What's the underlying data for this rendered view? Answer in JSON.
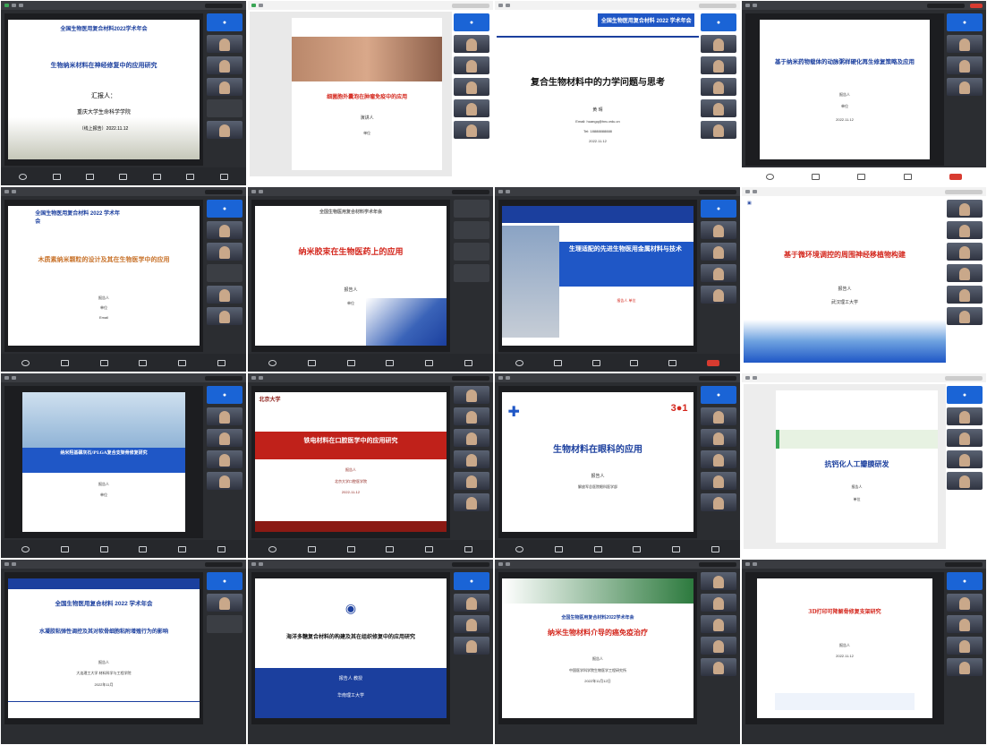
{
  "colors": {
    "red_title": "#d4271d",
    "blue_title": "#1b3f9e",
    "band_blue": "#1f57c6",
    "dark_band": "#8b1a14"
  },
  "cells": [
    {
      "id": "c1",
      "header": "全国生物医用复合材料2022学术年会",
      "title": "生物纳米材料在神经修复中的应用研究",
      "lines": [
        "汇报人：",
        "重庆大学生命科学学院",
        "（线上报告）2022.11.12"
      ]
    },
    {
      "id": "c2",
      "header": "",
      "title": "细菌胞外囊泡在肿瘤免疫中的应用",
      "lines": [
        "演讲人",
        "单位",
        ""
      ]
    },
    {
      "id": "c3",
      "header": "全国生物医用复合材料 2022 学术年会",
      "title": "复合生物材料中的力学问题与思考",
      "lines": [
        "黄  晴",
        "Email: huangq@hnu.edu.cn",
        "Tel: 18888888888",
        "2022.11.12"
      ]
    },
    {
      "id": "c4",
      "header": "",
      "title": "基于纳米药物载体的动脉粥样硬化再生修复策略及应用",
      "lines": [
        "报告人",
        "单位",
        "2022.11.12"
      ]
    },
    {
      "id": "c5",
      "header": "全国生物医用复合材料 2022 学术年会",
      "title": "木质素纳米颗粒的设计及其在生物医学中的应用",
      "lines": [
        "报告人",
        "单位",
        "Email"
      ]
    },
    {
      "id": "c6",
      "header": "全国生物医用复合材料学术年会",
      "title": "纳米胶束在生物医药上的应用",
      "lines": [
        "报告人",
        "单位"
      ]
    },
    {
      "id": "c7",
      "header": "",
      "title": "生理适配的先进生物医用金属材料与技术",
      "lines": [
        "报告人 单位"
      ]
    },
    {
      "id": "c8",
      "header": "",
      "title": "基于微环境调控的周围神经移植物构建",
      "lines": [
        "报告人",
        "武汉理工大学"
      ]
    },
    {
      "id": "c9",
      "header": "",
      "title": "纳米羟基磷灰石/PLGA复合支架骨修复研究",
      "lines": [
        "报告人",
        "单位"
      ]
    },
    {
      "id": "c10",
      "header": "北京大学",
      "title": "铁电材料在口腔医学中的应用研究",
      "lines": [
        "报告人",
        "北京大学口腔医学院",
        "2022-11-12"
      ]
    },
    {
      "id": "c11",
      "header": "",
      "title": "生物材料在眼科的应用",
      "lines": [
        "报告人",
        "解放军总医院眼科医学部"
      ]
    },
    {
      "id": "c12",
      "header": "",
      "title": "抗钙化人工瓣膜研发",
      "lines": [
        "报告人",
        "单位"
      ]
    },
    {
      "id": "c13",
      "header": "全国生物医用复合材料 2022 学术年会",
      "title": "水凝胶粘弹性调控及其对软骨细胞粘附增殖行为的影响",
      "lines": [
        "报告人",
        "大连理工大学 材料科学与工程学院",
        "2022年11月"
      ]
    },
    {
      "id": "c14",
      "header": "",
      "title": "海洋多糖复合材料的构建及其在组织修复中的应用研究",
      "lines": [
        "报告人 教授",
        "华南理工大学"
      ]
    },
    {
      "id": "c15",
      "header": "全国生物医用复合材料2022学术年会",
      "title": "纳米生物材料介导的癌免疫治疗",
      "lines": [
        "报告人",
        "中国医学科学院生物医学工程研究所",
        "2022年11月12日"
      ]
    },
    {
      "id": "c16",
      "header": "",
      "title": "3D打印可降解骨修复支架研究",
      "lines": [
        "报告人",
        "2022.11.12"
      ]
    }
  ]
}
